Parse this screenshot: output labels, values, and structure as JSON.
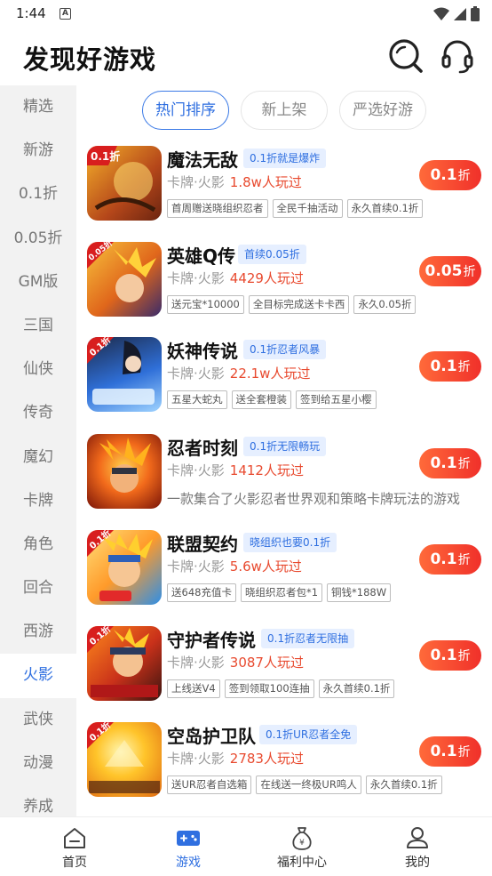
{
  "status_bar": {
    "time": "1:44",
    "notification_badge": "A"
  },
  "header": {
    "title": "发现好游戏"
  },
  "sidebar": {
    "categories": [
      "精选",
      "新游",
      "0.1折",
      "0.05折",
      "GM版",
      "三国",
      "仙侠",
      "传奇",
      "魔幻",
      "卡牌",
      "角色",
      "回合",
      "西游",
      "火影",
      "武侠",
      "动漫",
      "养成"
    ],
    "selected": "火影"
  },
  "tabs": [
    "热门排序",
    "新上架",
    "严选好游"
  ],
  "selected_tab": "热门排序",
  "games": [
    {
      "name": "魔法无敌",
      "promo": "0.1折就是爆炸",
      "genre": "卡牌·火影",
      "players": "1.8w人玩过",
      "tags": [
        "首周赠送晓组织忍者",
        "全民千抽活动",
        "永久首续0.1折"
      ],
      "discount": "0.1",
      "discount_unit": "折",
      "icon_label": "0.1折"
    },
    {
      "name": "英雄Q传",
      "promo": "首续0.05折",
      "genre": "卡牌·火影",
      "players": "4429人玩过",
      "tags": [
        "送元宝*10000",
        "全目标完成送卡卡西",
        "永久0.05折"
      ],
      "discount": "0.05",
      "discount_unit": "折",
      "icon_label": "0.05折"
    },
    {
      "name": "妖神传说",
      "promo": "0.1折忍者风暴",
      "genre": "卡牌·火影",
      "players": "22.1w人玩过",
      "tags": [
        "五星大蛇丸",
        "送全套橙装",
        "签到给五星小樱"
      ],
      "discount": "0.1",
      "discount_unit": "折",
      "icon_label": "0.1折"
    },
    {
      "name": "忍者时刻",
      "promo": "0.1折无限畅玩",
      "genre": "卡牌·火影",
      "players": "1412人玩过",
      "description": "一款集合了火影忍者世界观和策略卡牌玩法的游戏",
      "discount": "0.1",
      "discount_unit": "折"
    },
    {
      "name": "联盟契约",
      "promo": "晓组织也要0.1折",
      "genre": "卡牌·火影",
      "players": "5.6w人玩过",
      "tags": [
        "送648充值卡",
        "晓组织忍者包*1",
        "铜钱*188W"
      ],
      "discount": "0.1",
      "discount_unit": "折",
      "icon_label": "0.1折"
    },
    {
      "name": "守护者传说",
      "promo": "0.1折忍者无限抽",
      "genre": "卡牌·火影",
      "players": "3087人玩过",
      "tags": [
        "上线送V4",
        "签到领取100连抽",
        "永久首续0.1折"
      ],
      "discount": "0.1",
      "discount_unit": "折",
      "icon_label": "0.1折"
    },
    {
      "name": "空岛护卫队",
      "promo": "0.1折UR忍者全免",
      "genre": "卡牌·火影",
      "players": "2783人玩过",
      "tags": [
        "送UR忍者自选箱",
        "在线送一终极UR鸣人",
        "永久首续0.1折"
      ],
      "discount": "0.1",
      "discount_unit": "折",
      "icon_label": "0.1折"
    }
  ],
  "bottom_nav": [
    {
      "label": "首页",
      "icon": "home-icon"
    },
    {
      "label": "游戏",
      "icon": "gamepad-icon"
    },
    {
      "label": "福利中心",
      "icon": "money-bag-icon"
    },
    {
      "label": "我的",
      "icon": "user-icon"
    }
  ],
  "selected_nav": "游戏",
  "colors": {
    "accent": "#2f6fe0",
    "discount_button": "#f0302a",
    "players_count": "#e84a2f",
    "promo_bg": "#e6efff"
  }
}
